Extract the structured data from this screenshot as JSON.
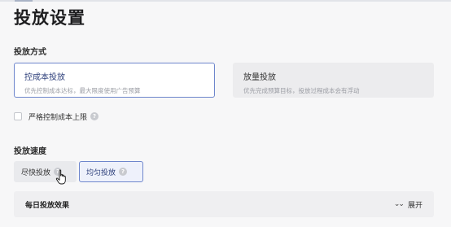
{
  "page": {
    "title": "投放设置"
  },
  "delivery_method": {
    "label": "投放方式",
    "options": [
      {
        "title": "控成本投放",
        "subtitle": "优先控制成本达标，最大限度使用广告预算",
        "selected": true
      },
      {
        "title": "放量投放",
        "subtitle": "优先完成预算目标，投放过程成本会有浮动",
        "selected": false
      }
    ],
    "strict_cost_cap": {
      "label": "严格控制成本上限",
      "checked": false,
      "help_icon": "help-icon"
    }
  },
  "delivery_speed": {
    "label": "投放速度",
    "options": [
      {
        "label": "尽快投放",
        "selected": false,
        "help_icon": "help-icon"
      },
      {
        "label": "均匀投放",
        "selected": true,
        "help_icon": "help-icon"
      }
    ]
  },
  "daily_effect": {
    "title": "每日投放效果",
    "expand_label": "展开",
    "icon": "chevron-double-down-icon"
  },
  "colors": {
    "accent": "#6e86cc",
    "accent_text": "#2c3e7a"
  }
}
